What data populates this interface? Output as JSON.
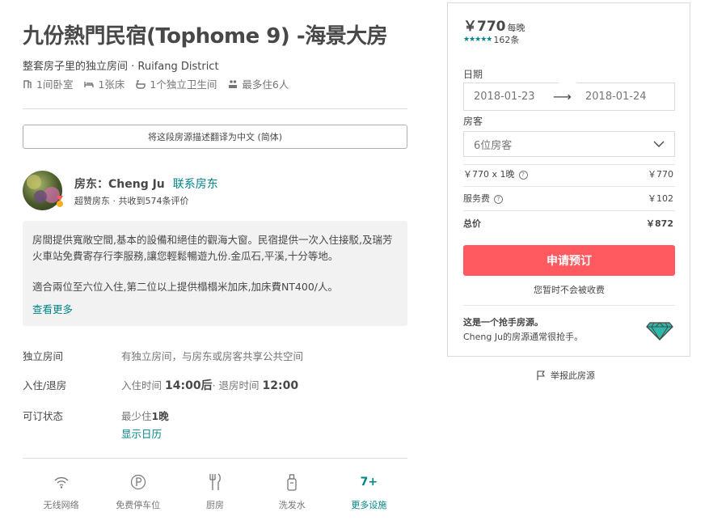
{
  "listing": {
    "title": "九份熱門民宿(Tophome 9) -海景大房",
    "subtitle": "整套房子里的独立房间 · Ruifang District",
    "summary": [
      {
        "icon": "bedroom-icon",
        "label": "1间卧室"
      },
      {
        "icon": "bed-icon",
        "label": "1张床"
      },
      {
        "icon": "bathtub-icon",
        "label": "1个独立卫生间"
      },
      {
        "icon": "guests-icon",
        "label": "最多住6人"
      }
    ],
    "translate_button": "将这段房源描述翻译为中文 (简体)"
  },
  "host": {
    "prefix": "房东：",
    "name": "Cheng Ju",
    "contact_link": "联系房东",
    "meta": "超赞房东 · 共收到574条评价"
  },
  "description": {
    "paragraph1": "房間提供寬敞空間,基本的設備和絕佳的觀海大窗。民宿提供一次入住接駁,及瑞芳火車站免費寄存行李服務,讓您輕鬆暢遊九份.金瓜石,平溪,十分等地。",
    "paragraph2": "適合兩位至六位入住,第二位以上提供榻榻米加床,加床費NT400/人。",
    "read_more": "查看更多"
  },
  "details": {
    "room_type_label": "独立房间",
    "room_type_value": "有独立房间，与房东或房客共享公共空间",
    "checkin_label": "入住/退房",
    "checkin_prefix": "入住时间",
    "checkin_time": "14:00后",
    "checkout_prefix": "· 退房时间",
    "checkout_time": "12:00",
    "availability_label": "可订状态",
    "min_stay_prefix": "最少住",
    "min_stay_value": "1晚",
    "calendar_link": "显示日历"
  },
  "amenities": [
    {
      "icon": "wifi-icon",
      "label": "无线网络"
    },
    {
      "icon": "parking-icon",
      "label": "免费停车位"
    },
    {
      "icon": "kitchen-icon",
      "label": "厨房"
    },
    {
      "icon": "shampoo-icon",
      "label": "洗发水"
    },
    {
      "icon": "more-amenities-icon",
      "count": "7+",
      "label": "更多设施"
    }
  ],
  "booking": {
    "price": "￥770",
    "price_unit": "每晚",
    "stars": "★★★★★",
    "review_count": "162条",
    "dates_label": "日期",
    "checkin_date": "2018-01-23",
    "checkout_date": "2018-01-24",
    "guests_label": "房客",
    "guests_value": "6位房客",
    "nightly_calc": "￥770 x 1晚",
    "nightly_total": "￥770",
    "service_fee_label": "服务费",
    "service_fee": "￥102",
    "total_label": "总价",
    "total": "￥872",
    "book_button": "申请预订",
    "no_charge_note": "您暂时不会被收费",
    "rare_title": "这是一个抢手房源。",
    "rare_sub": "Cheng Ju的房源通常很抢手。",
    "report_link": "举报此房源"
  },
  "colors": {
    "accent_teal": "#008489",
    "book_button": "#ff5a5f",
    "text": "#484848",
    "muted": "#767676"
  }
}
